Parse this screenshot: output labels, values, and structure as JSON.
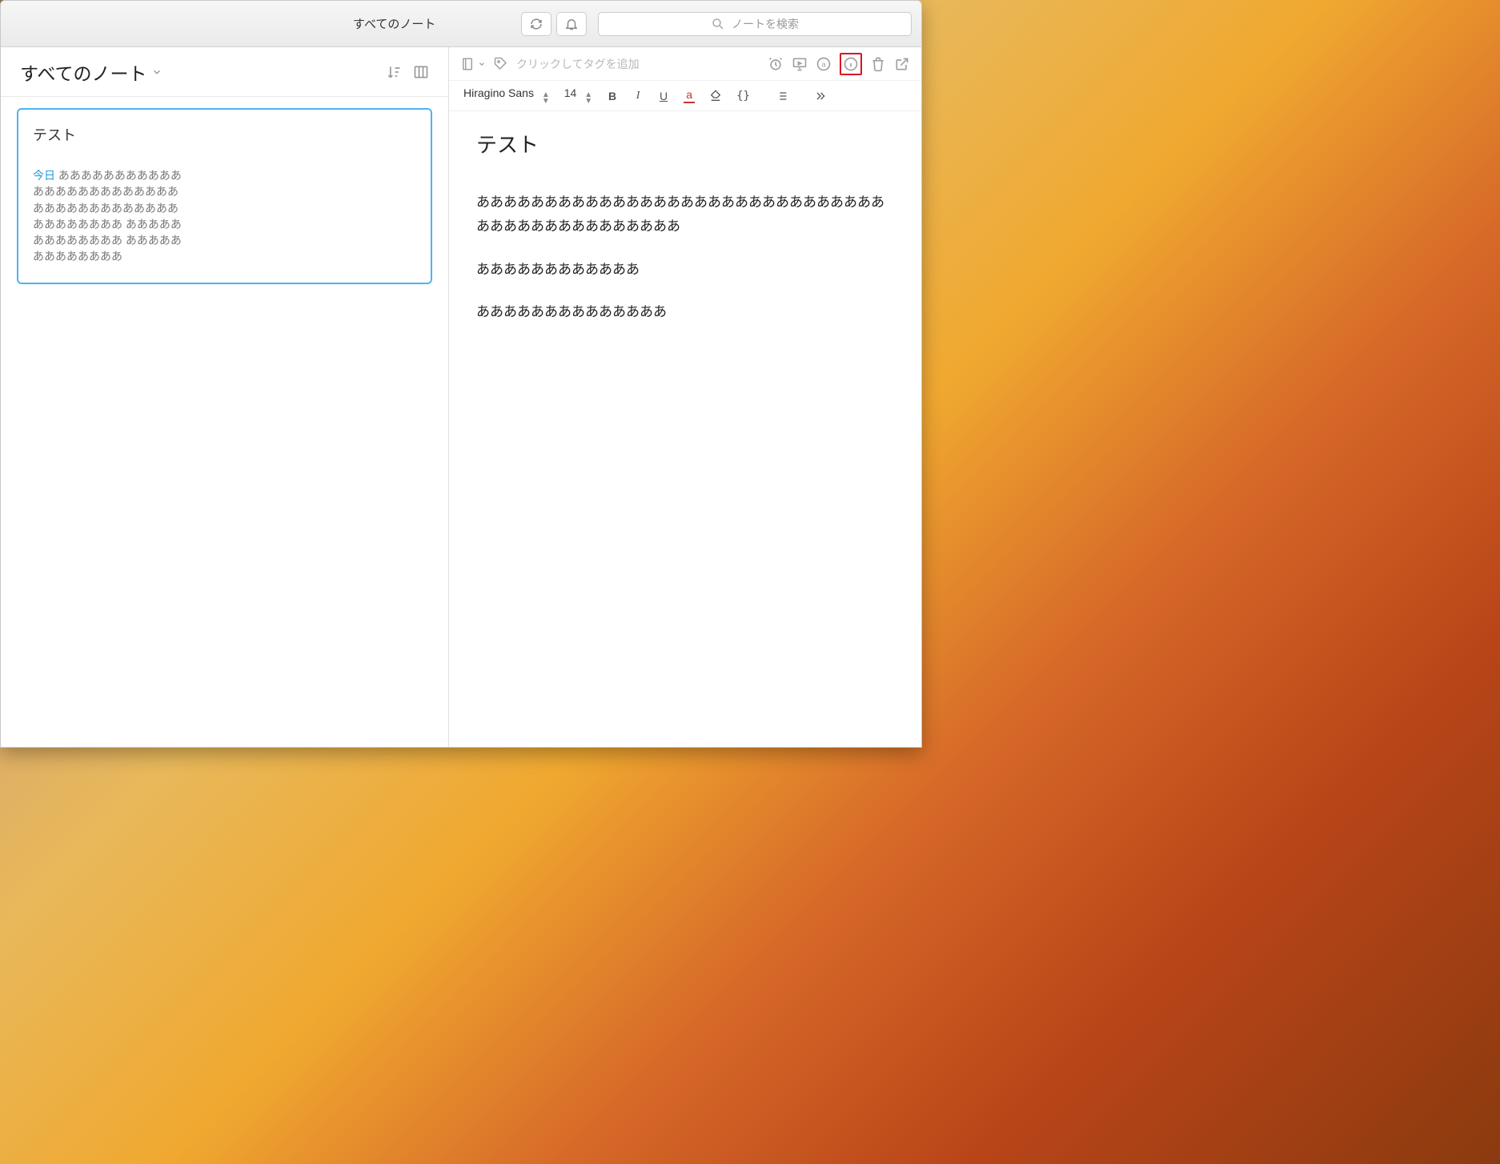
{
  "titlebar": {
    "title": "すべてのノート",
    "search_placeholder": "ノートを検索"
  },
  "list_pane": {
    "title": "すべてのノート"
  },
  "note_card": {
    "title": "テスト",
    "preview_today_label": "今日",
    "preview_lines": [
      "あああああああああああ",
      "あああああああああああああ",
      "あああああああああああああ",
      "ああああああああ あああああ",
      "ああああああああ あああああ",
      "ああああああああ"
    ]
  },
  "editor": {
    "tag_placeholder": "クリックしてタグを追加",
    "font_name": "Hiragino Sans",
    "font_size": "14",
    "doc_title": "テスト",
    "paragraphs": [
      "あああああああああああああああああああああああああああああああああああああああああああああ",
      "ああああああああああああ",
      "ああああああああああああああ"
    ]
  }
}
